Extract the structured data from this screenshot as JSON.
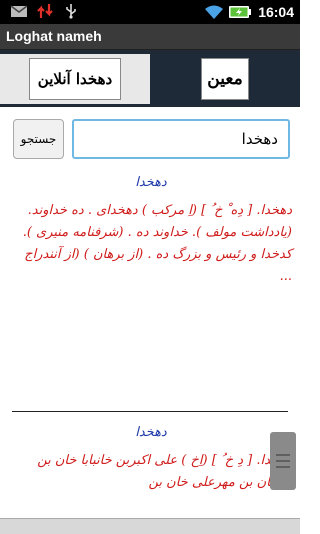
{
  "status_bar": {
    "time": "16:04",
    "icons": [
      "mail-icon",
      "sync-arrows-icon",
      "usb-icon",
      "wifi-icon",
      "battery-charging-icon"
    ]
  },
  "app": {
    "title": "Loghat nameh"
  },
  "tabs": [
    {
      "label": "دهخدا آنلاین"
    },
    {
      "label": "معین"
    }
  ],
  "search": {
    "button_label": "جستجو",
    "query_value": "دهخدا"
  },
  "results": [
    {
      "heading": "دهخدا",
      "text": "دهخدا. [ دِه ْ خ ُ ] (اِ مرکب ) دهخدای . ده خداوند. (یادداشت مولف ). خداوند ده . (شرفنامه منیری ). کدخدا و رئیس و بزرگ ده . (از برهان ) (از آنندراج ..."
    },
    {
      "heading": "دهخدا",
      "text": "دهخدا. [ دِ خ ُ ] (اِخ ) علی اکبربن خانبابا خان بن آقاخان بن مهرعلی خان بن"
    }
  ],
  "colors": {
    "heading": "#1f3aa8",
    "body_text": "#d01b1b",
    "input_focus": "#6fb8e3"
  }
}
